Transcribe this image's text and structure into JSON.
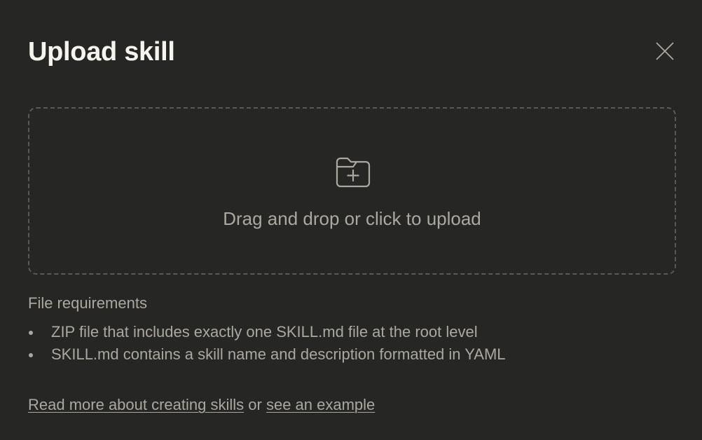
{
  "dialog": {
    "title": "Upload skill",
    "close_icon": "close-icon"
  },
  "dropzone": {
    "icon": "folder-plus-icon",
    "text": "Drag and drop or click to upload"
  },
  "requirements": {
    "heading": "File requirements",
    "items": [
      "ZIP file that includes exactly one SKILL.md file at the root level",
      "SKILL.md contains a skill name and description formatted in YAML"
    ]
  },
  "footer": {
    "link_read_more": "Read more about creating skills",
    "connector": " or ",
    "link_example": "see an example"
  },
  "colors": {
    "background": "#262624",
    "title": "#f5f4ef",
    "text": "#a9a8a1",
    "border": "#5a5955"
  }
}
